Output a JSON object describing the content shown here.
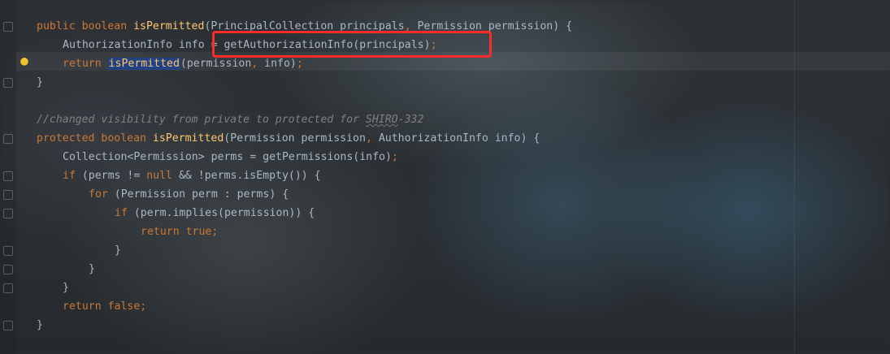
{
  "editor": {
    "lines": [
      {
        "indent": 0,
        "parts": [
          {
            "t": "public boolean ",
            "cls": "k"
          },
          {
            "t": "isPermitted",
            "cls": "fn"
          },
          {
            "t": "(PrincipalCollection principals",
            "cls": ""
          },
          {
            "t": ", ",
            "cls": "k"
          },
          {
            "t": "Permission permission) {",
            "cls": ""
          }
        ]
      },
      {
        "indent": 1,
        "parts": [
          {
            "t": "AuthorizationInfo info = getAuthorizationInfo(principals)",
            "cls": ""
          },
          {
            "t": ";",
            "cls": "k"
          }
        ]
      },
      {
        "indent": 1,
        "parts": [
          {
            "t": "return ",
            "cls": "k"
          },
          {
            "t": "isPermitted",
            "cls": "hl"
          },
          {
            "t": "(permission",
            "cls": ""
          },
          {
            "t": ", ",
            "cls": "k"
          },
          {
            "t": "info)",
            "cls": ""
          },
          {
            "t": ";",
            "cls": "k"
          }
        ]
      },
      {
        "indent": 0,
        "parts": [
          {
            "t": "}",
            "cls": ""
          }
        ]
      },
      {
        "indent": 0,
        "parts": []
      },
      {
        "indent": 0,
        "parts": [
          {
            "t": "//changed visibility from private to protected for ",
            "cls": "c"
          },
          {
            "t": "SHIRO",
            "cls": "c typo"
          },
          {
            "t": "-332",
            "cls": "c"
          }
        ]
      },
      {
        "indent": 0,
        "parts": [
          {
            "t": "protected boolean ",
            "cls": "k"
          },
          {
            "t": "isPermitted",
            "cls": "fn"
          },
          {
            "t": "(Permission permission",
            "cls": ""
          },
          {
            "t": ", ",
            "cls": "k"
          },
          {
            "t": "AuthorizationInfo info) {",
            "cls": ""
          }
        ]
      },
      {
        "indent": 1,
        "parts": [
          {
            "t": "Collection<Permission> perms = getPermissions(info)",
            "cls": ""
          },
          {
            "t": ";",
            "cls": "k"
          }
        ]
      },
      {
        "indent": 1,
        "parts": [
          {
            "t": "if ",
            "cls": "k"
          },
          {
            "t": "(perms != ",
            "cls": ""
          },
          {
            "t": "null ",
            "cls": "k"
          },
          {
            "t": "&& !perms.isEmpty()) {",
            "cls": ""
          }
        ]
      },
      {
        "indent": 2,
        "parts": [
          {
            "t": "for ",
            "cls": "k"
          },
          {
            "t": "(Permission perm : perms) {",
            "cls": ""
          }
        ]
      },
      {
        "indent": 3,
        "parts": [
          {
            "t": "if ",
            "cls": "k"
          },
          {
            "t": "(perm.implies(permission)) {",
            "cls": ""
          }
        ]
      },
      {
        "indent": 4,
        "parts": [
          {
            "t": "return true;",
            "cls": "k"
          }
        ]
      },
      {
        "indent": 3,
        "parts": [
          {
            "t": "}",
            "cls": ""
          }
        ]
      },
      {
        "indent": 2,
        "parts": [
          {
            "t": "}",
            "cls": ""
          }
        ]
      },
      {
        "indent": 1,
        "parts": [
          {
            "t": "}",
            "cls": ""
          }
        ]
      },
      {
        "indent": 1,
        "parts": [
          {
            "t": "return false;",
            "cls": "k"
          }
        ]
      },
      {
        "indent": 0,
        "parts": [
          {
            "t": "}",
            "cls": ""
          }
        ]
      }
    ]
  },
  "gutter": {
    "intention_icon": "lightbulb-icon",
    "fold_icon": "fold-marker-icon"
  },
  "colors": {
    "keyword": "#cc7832",
    "function": "#ffc66d",
    "text": "#a9b7c6",
    "comment": "#808080",
    "annotation_box": "#ff2b2b",
    "usage_highlight": "#214283"
  }
}
